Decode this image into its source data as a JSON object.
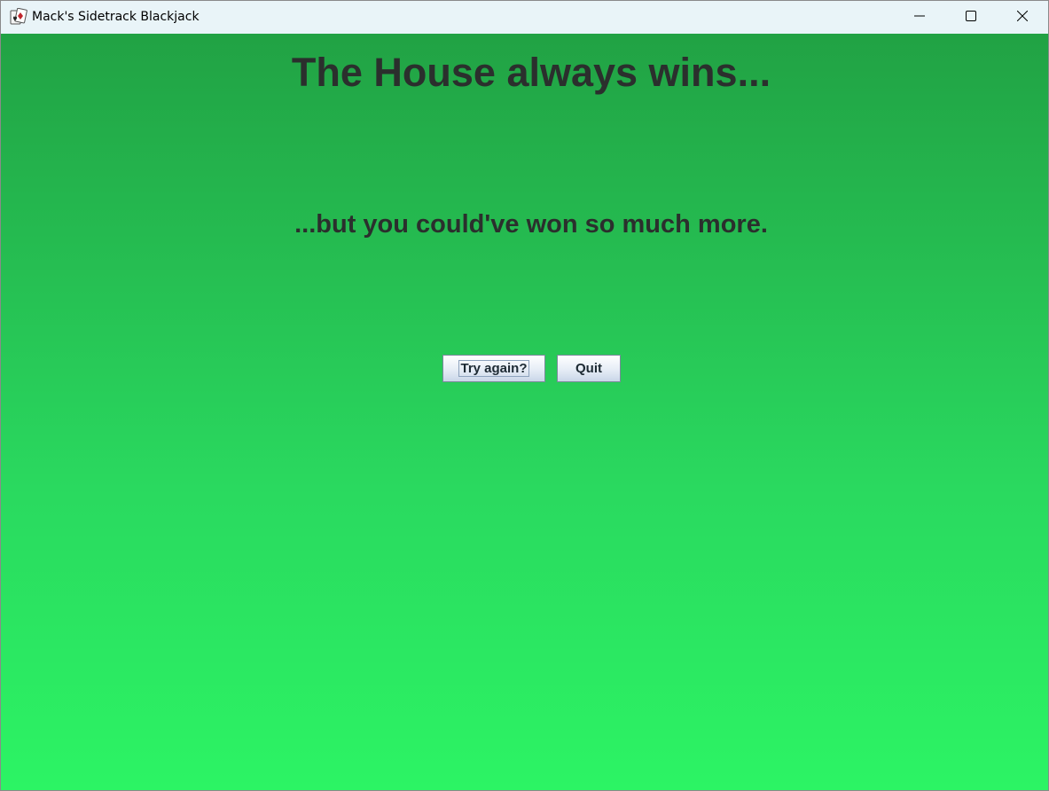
{
  "window": {
    "title": "Mack's Sidetrack Blackjack",
    "icon": "playing-cards-icon"
  },
  "titlebar_controls": {
    "minimize_icon": "minimize-icon",
    "maximize_icon": "maximize-icon",
    "close_icon": "close-icon"
  },
  "main": {
    "heading": "The House always wins...",
    "subheading": "...but you could've won so much more.",
    "buttons": {
      "try_again": "Try again?",
      "quit": "Quit"
    }
  },
  "colors": {
    "background_top": "#21a244",
    "background_bottom": "#2cf464",
    "text": "#2b2f2d"
  }
}
